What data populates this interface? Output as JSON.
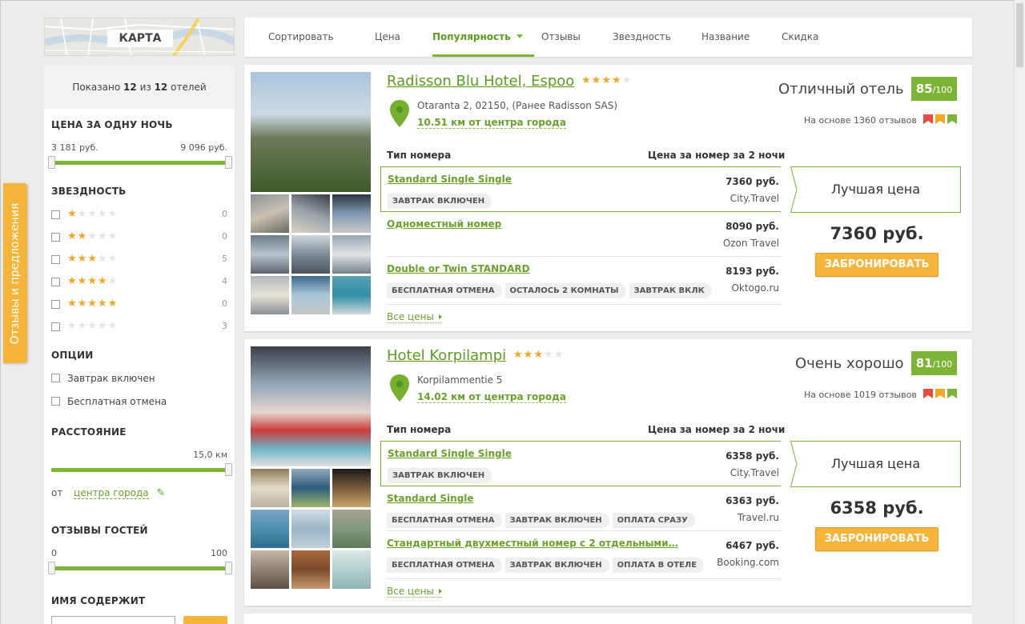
{
  "side_tab": {
    "label": "Отзывы и предложения"
  },
  "map": {
    "label": "КАРТА"
  },
  "sidebar": {
    "shown_prefix": "Показано",
    "shown_count": "12",
    "shown_middle": "из",
    "shown_total": "12",
    "shown_suffix": "отелей",
    "price": {
      "title": "ЦЕНА ЗА ОДНУ НОЧЬ",
      "min": "3 181 руб.",
      "max": "9 096 руб."
    },
    "stars": {
      "title": "ЗВЕЗДНОСТЬ",
      "rows": [
        {
          "stars": 1,
          "count": "0"
        },
        {
          "stars": 2,
          "count": "0"
        },
        {
          "stars": 3,
          "count": "5"
        },
        {
          "stars": 4,
          "count": "4"
        },
        {
          "stars": 5,
          "count": "0"
        },
        {
          "stars": 0,
          "count": "3"
        }
      ]
    },
    "options": {
      "title": "ОПЦИИ",
      "items": [
        "Завтрак включен",
        "Бесплатная отмена"
      ]
    },
    "distance": {
      "title": "РАССТОЯНИЕ",
      "value": "15,0 км",
      "from_label": "от",
      "from_link": "центра города"
    },
    "reviews": {
      "title": "ОТЗЫВЫ ГОСТЕЙ",
      "min": "0",
      "max": "100"
    },
    "name": {
      "title": "ИМЯ СОДЕРЖИТ"
    }
  },
  "sortbar": {
    "items": [
      "Сортировать",
      "Цена",
      "Популярность",
      "Отзывы",
      "Звездность",
      "Название",
      "Скидка"
    ],
    "active": "Популярность"
  },
  "hotels": [
    {
      "name": "Radisson Blu Hotel, Espoo",
      "stars": 4,
      "address": "Otaranta 2, 02150, (Ранее Radisson SAS)",
      "distance": "10.51 км от центра города",
      "rating_text": "Отличный отель",
      "rating_score": "85",
      "rating_max": "/100",
      "based_on": "На основе 1360 отзывов",
      "col_room": "Тип номера",
      "col_price": "Цена за номер за 2 ночи",
      "rooms": [
        {
          "name": "Standard Single Single",
          "tags": [
            "ЗАВТРАК ВКЛЮЧЕН"
          ],
          "price": "7360 руб.",
          "site": "City.Travel"
        },
        {
          "name": "Одноместный номер",
          "tags": [],
          "price": "8090 руб.",
          "site": "Ozon Travel"
        },
        {
          "name": "Double or Twin STANDARD",
          "tags": [
            "БЕСПЛАТНАЯ ОТМЕНА",
            "ОСТАЛОСЬ 2 КОМНАТЫ",
            "ЗАВТРАК ВКЛК"
          ],
          "price": "8193 руб.",
          "site": "Oktogo.ru"
        }
      ],
      "best_label": "Лучшая цена",
      "best_price": "7360 руб.",
      "book_label": "ЗАБРОНИРОВАТЬ",
      "all_prices": "Все цены"
    },
    {
      "name": "Hotel Korpilampi",
      "stars": 3,
      "address": "Korpilammentie 5",
      "distance": "14.02 км от центра города",
      "rating_text": "Очень хорошо",
      "rating_score": "81",
      "rating_max": "/100",
      "based_on": "На основе 1019 отзывов",
      "col_room": "Тип номера",
      "col_price": "Цена за номер за 2 ночи",
      "rooms": [
        {
          "name": "Standard Single Single",
          "tags": [
            "ЗАВТРАК ВКЛЮЧЕН"
          ],
          "price": "6358 руб.",
          "site": "City.Travel"
        },
        {
          "name": "Standard Single",
          "tags": [
            "БЕСПЛАТНАЯ ОТМЕНА",
            "ЗАВТРАК ВКЛЮЧЕН",
            "ОПЛАТА СРАЗУ"
          ],
          "price": "6363 руб.",
          "site": "Travel.ru"
        },
        {
          "name": "Стандартный двухместный номер с 2 отдельными…",
          "tags": [
            "БЕСПЛАТНАЯ ОТМЕНА",
            "ЗАВТРАК ВКЛЮЧЕН",
            "ОПЛАТА В ОТЕЛЕ"
          ],
          "price": "6467 руб.",
          "site": "Booking.com"
        }
      ],
      "best_label": "Лучшая цена",
      "best_price": "6358 руб.",
      "book_label": "ЗАБРОНИРОВАТЬ",
      "all_prices": "Все цены"
    }
  ],
  "colors": {
    "green": "#7cb535",
    "link_green": "#6aa12b",
    "orange": "#f5b53a",
    "star": "#f5a623"
  }
}
